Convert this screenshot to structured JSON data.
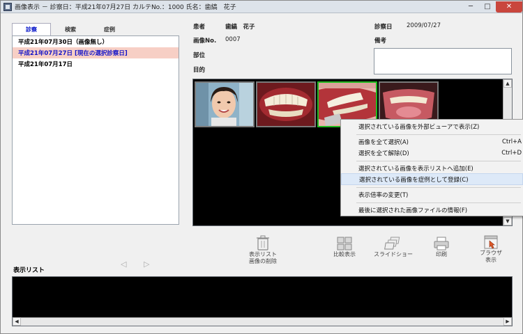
{
  "window": {
    "title": "画像表示 － 診察日：平成21年07月27日 カルテNo.：1000 氏名：歯縞　花子",
    "minimize": "─",
    "maximize": "□",
    "close": "✕"
  },
  "tabs": [
    "診察",
    "検索",
    "症例"
  ],
  "dates": [
    {
      "label": "平成21年07月30日（画像無し）",
      "selected": false
    },
    {
      "label": "平成21年07月27日 [現在の選択診察日]",
      "selected": true
    },
    {
      "label": "平成21年07月17日",
      "selected": false
    }
  ],
  "patient": {
    "patient_label": "患者",
    "patient_name": "歯縞　花子",
    "image_no_label": "画像No.",
    "image_no": "0007",
    "region_label": "部位",
    "purpose_label": "目的",
    "exam_date_label": "診察日",
    "exam_date": "2009/07/27",
    "memo_label": "備考"
  },
  "thumbnails": [
    {
      "name": "portrait",
      "selected": false
    },
    {
      "name": "front-teeth",
      "selected": false
    },
    {
      "name": "side-teeth",
      "selected": true
    },
    {
      "name": "lower-teeth",
      "selected": false
    }
  ],
  "context_menu": [
    {
      "label": "選択されている画像を外部ビューアで表示(Z)",
      "shortcut": ""
    },
    {
      "label": "画像を全て選択(A)",
      "shortcut": "Ctrl+A"
    },
    {
      "label": "選択を全て解除(D)",
      "shortcut": "Ctrl+D"
    },
    {
      "label": "選択されている画像を表示リストへ追加(E)",
      "shortcut": ""
    },
    {
      "label": "選択されている画像を症例として登録(C)",
      "shortcut": ""
    },
    {
      "label": "表示倍率の変更(T)",
      "shortcut": ""
    },
    {
      "label": "最後に選択された画像ファイルの情報(F)",
      "shortcut": ""
    }
  ],
  "toolbar": {
    "delete_line1": "表示リスト",
    "delete_line2": "画像の削除",
    "compare": "比較表示",
    "slideshow": "スライドショー",
    "print": "印刷",
    "browser_line1": "ブラウザ",
    "browser_line2": "表示"
  },
  "nav": {
    "prev": "◁",
    "next": "▷"
  },
  "display_list": {
    "title": "表示リスト"
  },
  "scroll": {
    "up": "▲",
    "down": "▼",
    "left": "◀",
    "right": "▶"
  }
}
